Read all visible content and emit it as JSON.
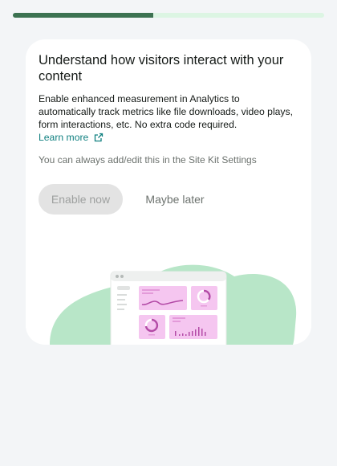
{
  "progress": {
    "value": 0.45
  },
  "banner": {
    "title": "Understand how visitors interact with your content",
    "description": "Enable enhanced measurement in Analytics to automatically track metrics like file downloads, video plays, form interactions, etc. No extra code required.",
    "learn_more": "Learn more",
    "note": "You can always add/edit this in the Site Kit Settings"
  },
  "actions": {
    "enable_label": "Enable now",
    "later_label": "Maybe later"
  },
  "colors": {
    "progress_fill": "#3c7251",
    "progress_track": "#dcf5e3",
    "link": "#108080",
    "blob": "#b8e6c8",
    "dashboard_accent": "#f5c6f0"
  },
  "icons": {
    "learn_more": "external-link-icon"
  }
}
